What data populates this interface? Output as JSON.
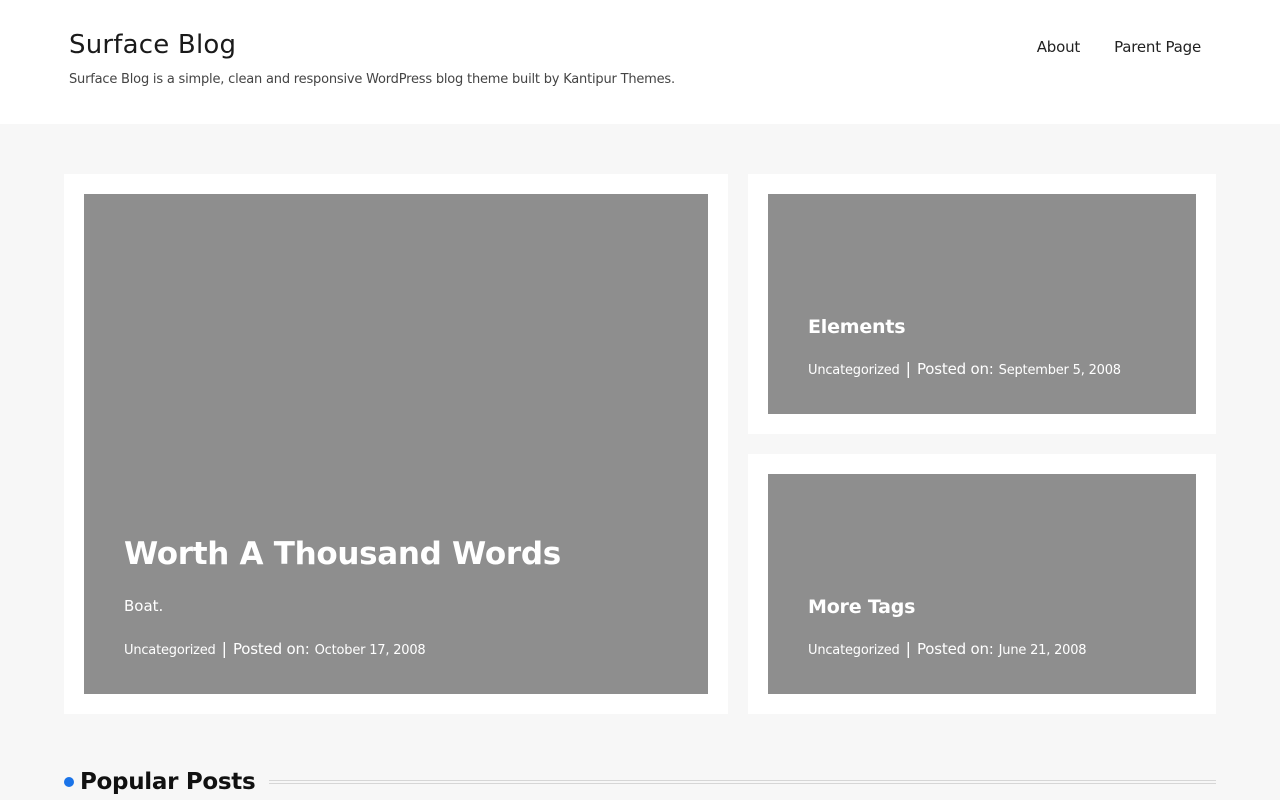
{
  "site": {
    "title": "Surface Blog",
    "description": "Surface Blog is a simple, clean and responsive WordPress blog theme built by Kantipur Themes."
  },
  "nav": {
    "items": [
      {
        "label": "About"
      },
      {
        "label": "Parent Page"
      }
    ]
  },
  "featured": {
    "main": {
      "title": "Worth A Thousand Words",
      "excerpt": "Boat.",
      "category": "Uncategorized",
      "separator": "|",
      "posted_label": "Posted on:",
      "date": "October 17, 2008"
    },
    "side": [
      {
        "title": "Elements",
        "category": "Uncategorized",
        "separator": "|",
        "posted_label": "Posted on:",
        "date": "September 5, 2008"
      },
      {
        "title": "More Tags",
        "category": "Uncategorized",
        "separator": "|",
        "posted_label": "Posted on:",
        "date": "June 21, 2008"
      }
    ]
  },
  "popular": {
    "title": "Popular Posts"
  },
  "colors": {
    "accent": "#1a73e8",
    "image_placeholder": "#8e8e8e",
    "page_background": "#f7f7f7"
  }
}
